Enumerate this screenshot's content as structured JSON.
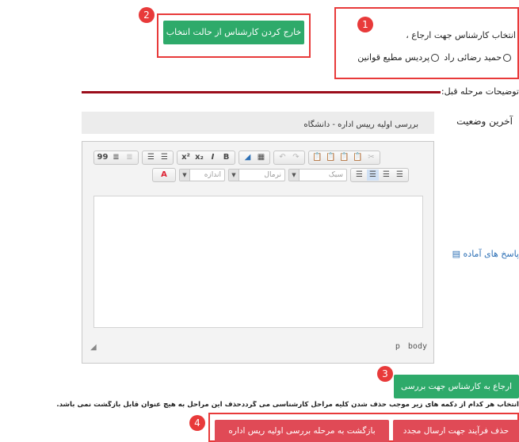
{
  "step_badges": [
    "1",
    "2",
    "3",
    "4"
  ],
  "referral": {
    "label": "انتخاب کارشناس جهت ارجاع ،",
    "options": [
      "حمید رضائی راد",
      "پردیس مطیع قوانین"
    ]
  },
  "deselect_button": "خارج کردن کارشناس از حالت انتخاب",
  "prev_step_heading": "توضیحات مرحله قبل:",
  "last_status": {
    "label": "آخرین وضعیت",
    "value": "بررسی اولیه رییس اداره - دانشگاه"
  },
  "ready_replies_link": "پاسخ های آماده",
  "editor": {
    "toolbar_row1": [
      "✂",
      "📋",
      "📋",
      "📋",
      "📋",
      "↶",
      "↷",
      "▦",
      "◢",
      "B",
      "I",
      "x₂",
      "x²",
      "☰",
      "☰",
      "☰",
      "☰",
      "99"
    ],
    "combos": [
      "سبک",
      "نرمال",
      "اندازه"
    ],
    "font_color": "A",
    "status_path": [
      "body",
      "p"
    ]
  },
  "refer_button": "ارجاع به کارشناس جهت بررسی",
  "warning_text": "انتخاب هر کدام از دکمه های زیر موجب حذف شدن کلیه مراحل کارشناسی می گرددحذف این مراحل به هیچ عنوان قابل بازگشت نمی باشد.",
  "delete_button": "حذف فرآیند جهت ارسال مجدد",
  "return_button": "بازگشت به مرحله بررسی اولیه ریس اداره",
  "colors": {
    "green": "#2eaa6a",
    "red_button": "#e04a56",
    "annotation": "#e83a3a",
    "divider": "#9b0d1b",
    "link": "#2c6fb5"
  }
}
